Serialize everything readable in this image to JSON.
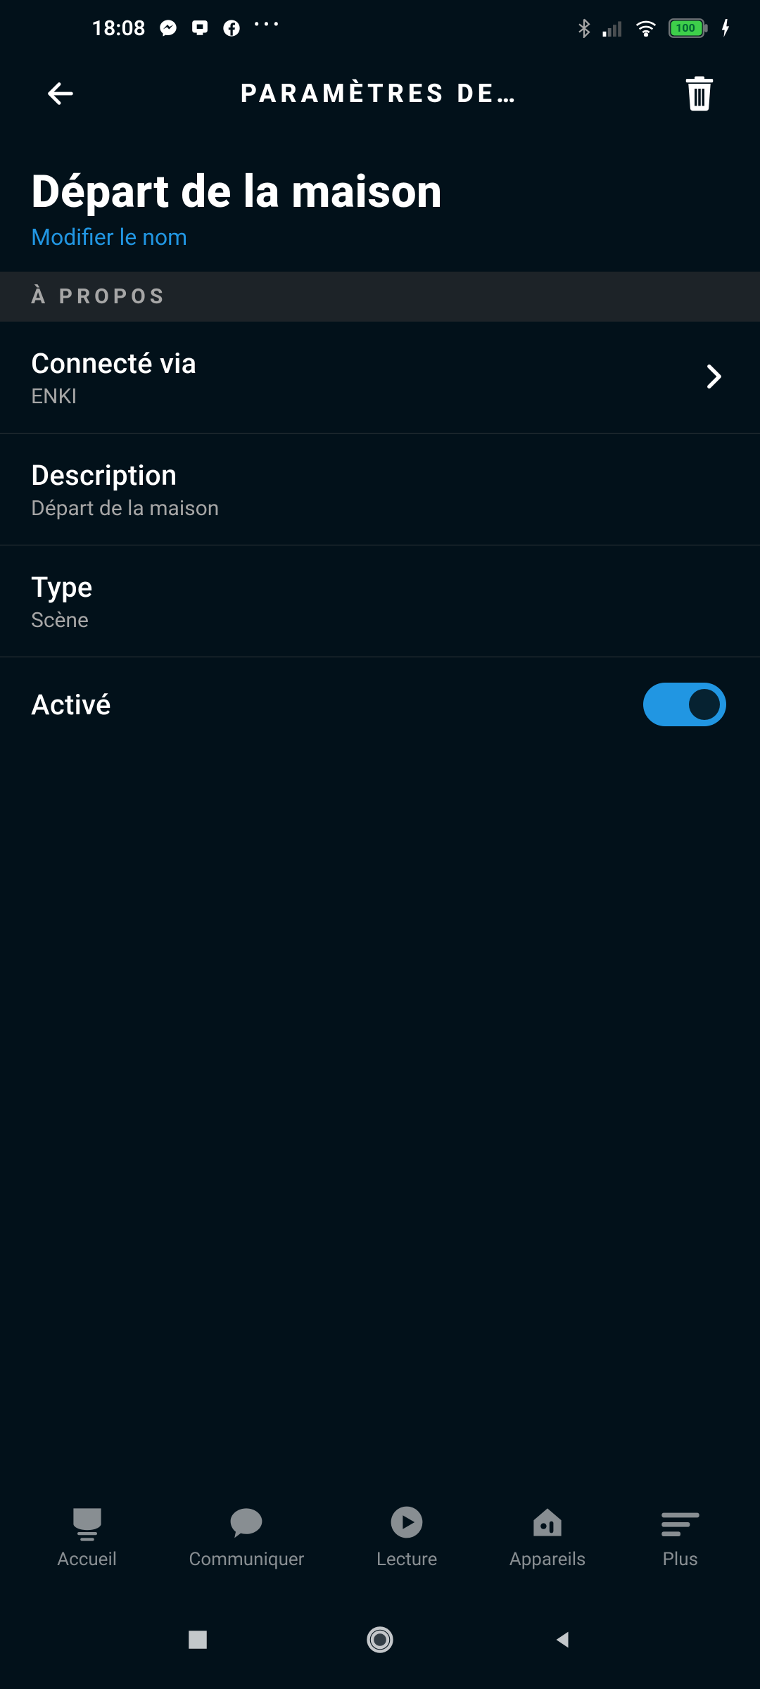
{
  "status": {
    "time": "18:08",
    "battery": "100"
  },
  "appbar": {
    "title": "PARAMÈTRES DE…"
  },
  "heading": {
    "title": "Départ de la maison",
    "edit": "Modifier le nom"
  },
  "section": {
    "about": "À PROPOS"
  },
  "rows": {
    "connected": {
      "title": "Connecté via",
      "value": "ENKI"
    },
    "description": {
      "title": "Description",
      "value": "Départ de la maison"
    },
    "type": {
      "title": "Type",
      "value": "Scène"
    },
    "enabled": {
      "title": "Activé"
    }
  },
  "tabs": {
    "home": "Accueil",
    "communicate": "Communiquer",
    "play": "Lecture",
    "devices": "Appareils",
    "more": "Plus"
  }
}
